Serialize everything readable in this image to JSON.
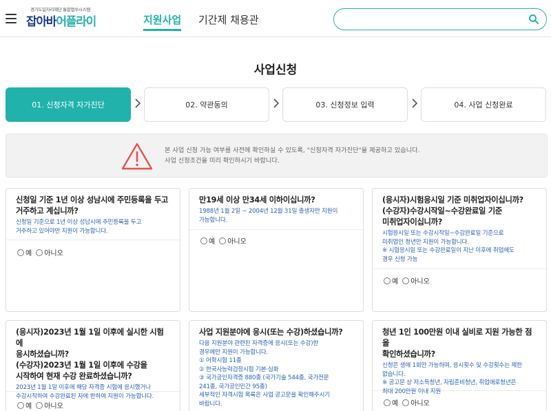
{
  "header": {
    "logo_sub": "경기도일자리재단 통합접수시스템",
    "logo_part1": "잡아바",
    "logo_part2": "어플라이",
    "nav": [
      "지원사업",
      "기간제 채용관"
    ],
    "search_placeholder": ""
  },
  "page_title": "사업신청",
  "steps": [
    {
      "label": "01. 신청자격 자가진단",
      "active": true
    },
    {
      "label": "02. 약관동의",
      "active": false
    },
    {
      "label": "03. 신청정보 입력",
      "active": false
    },
    {
      "label": "04. 사업 신청완료",
      "active": false
    }
  ],
  "notice": {
    "line1": "본 사업 신청 가능 여부를 사전에 확인하실 수 있도록, \"신청자격 자가진단\"을 제공하고 있습니다.",
    "line2": "사업 신청조건을 미리 확인하시기 바랍니다."
  },
  "radio_labels": {
    "yes": "예",
    "no": "아니오"
  },
  "questions": [
    {
      "question": [
        "신청일 기준 1년 이상 성남시에 주민등록을 두고",
        "거주하고 계십니까?"
      ],
      "desc": [
        "신청일 기준으로 1년 이상 성남시에 주민등록을 두고",
        "거주하고 있어야만 지원이 가능합니다."
      ]
    },
    {
      "question": [
        "만19세 이상 만34세 이하이십니까?"
      ],
      "desc": [
        "1988년 1월 2일 ~ 2004년 12월 31일 출생자만 지원이",
        "가능합니다."
      ]
    },
    {
      "question": [
        "(응시자)시험응시일 기준 미취업자이십니까?",
        "(수강자)수강시작일~수강완료일 기준",
        "미취업자이십니까?"
      ],
      "desc": [
        "시험응시일 또는 수강시작일~수강완료일 기준으로",
        "미취업인 청년만 지원이 가능합니다.",
        "※ 시험응시일 또는 수강완료일이 지난 이후에 취업에도",
        "경우 신청 가능"
      ]
    },
    {
      "question": [
        "(응시자)2023년 1월 1일 이후에 실시한 시험에",
        "응시하셨습니까?",
        "(수강자)2023년 1월 1일 이후에 수강을",
        "시작하여 현재 수강 완료하셨습니까?"
      ],
      "desc": [
        "2023년 1월 1일 이후에 해당 자격증 시험에 응시했거나",
        "수강시작하여 수강완료된 자에 한하여 지원이 가능합니다."
      ]
    },
    {
      "question": [
        "사업 지원분야에 응시(또는 수강)하셨습니까?"
      ],
      "desc": [
        "다음 지원분야 관련된 자격증에 응시(또는 수강)한",
        "경우에만 지원이 가능합니다.",
        "① 어학시험 11종",
        "② 한국사능력검정시험 기본·심화",
        "③ 국가공인자격증 880종 (국가기술 544종, 국가전문",
        "241종, 국가공인민간 95종)",
        "세부적인 자격시험 목록은 사업 공고문을 확인해주시기",
        "바랍니다."
      ]
    },
    {
      "question": [
        "청년 1인 100만원 이내 실비로 지원 가능한 점을",
        "확인하셨습니까?"
      ],
      "desc": [
        "신청은 생애 1회만 가능하며, 응시횟수 및 수강횟수는 제한",
        "없습니다.",
        "※ 공고문 상 저소득청년, 자립준비청년, 취업애로청년은",
        "최대 200만원 이내 지원"
      ]
    }
  ]
}
